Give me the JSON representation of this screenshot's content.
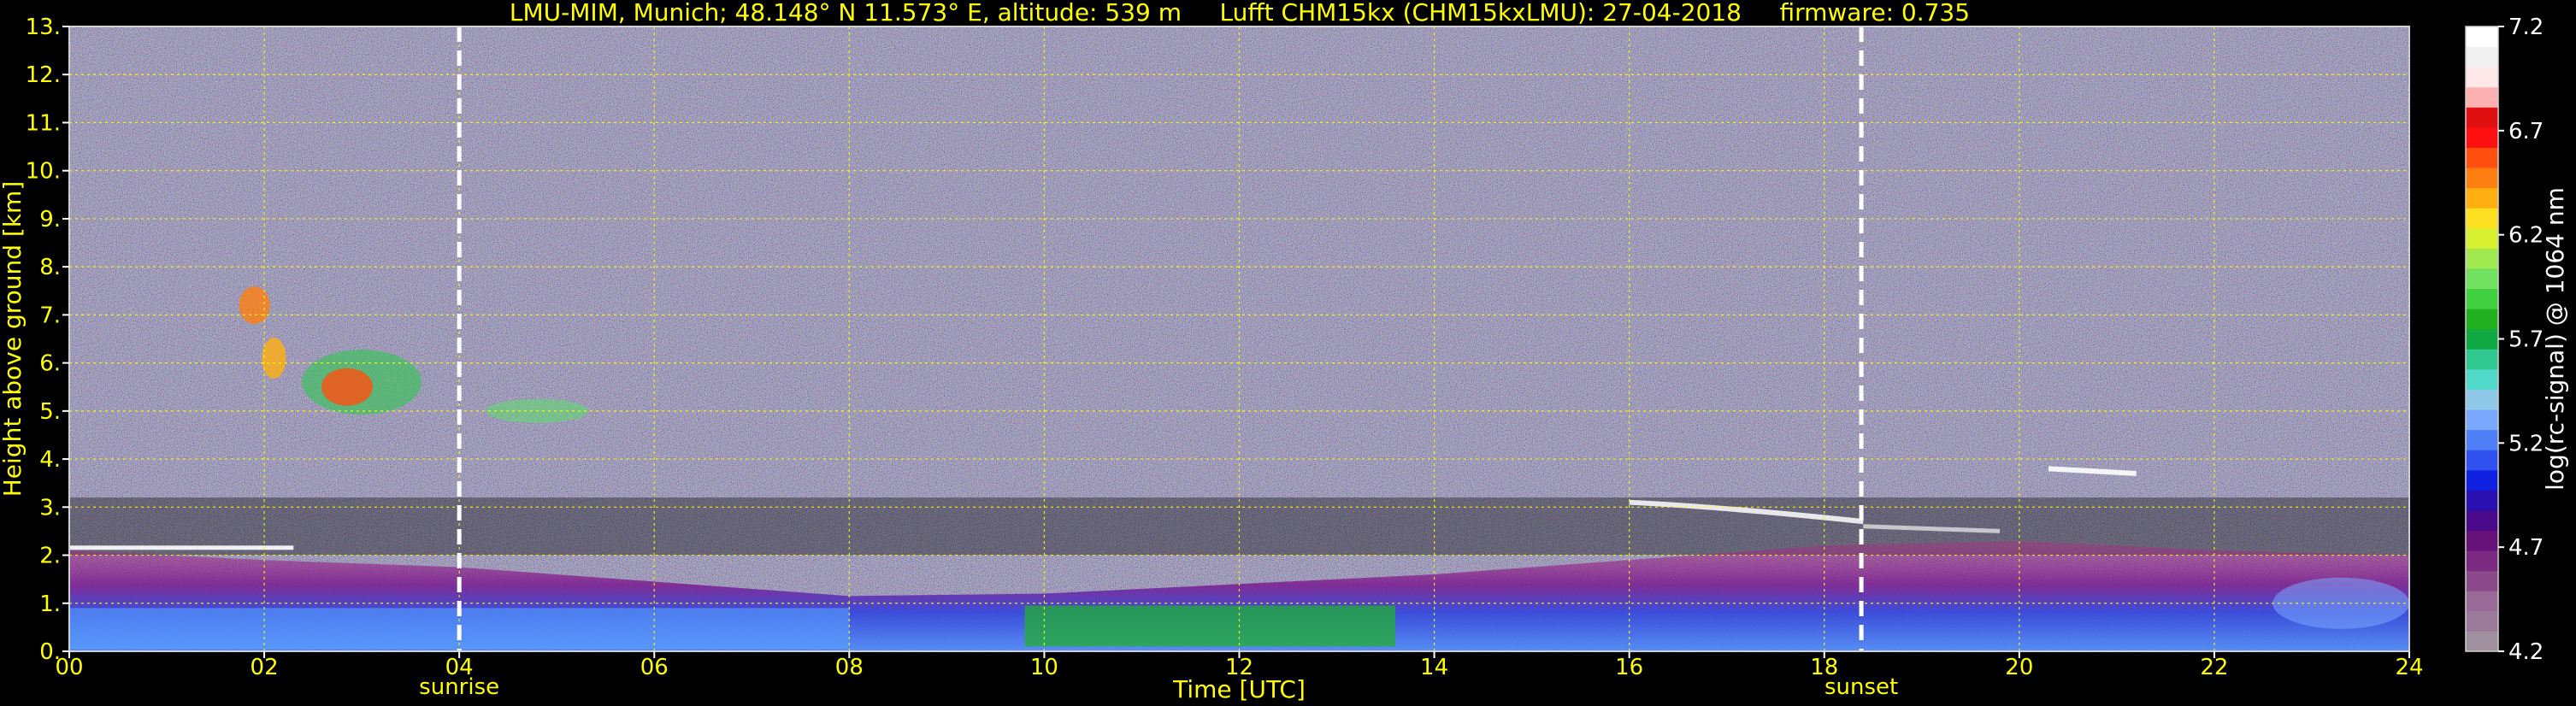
{
  "chart_data": {
    "type": "heatmap",
    "title": "LMU-MIM, Munich; 48.148° N 11.573° E, altitude: 539 m     Lufft CHM15kx (CHM15kxLMU): 27-04-2018     firmware: 0.735",
    "xlabel": "Time [UTC]",
    "ylabel": "Height above ground [km]",
    "xlim": [
      0,
      24
    ],
    "ylim": [
      0,
      13
    ],
    "x_ticks": [
      "00",
      "02",
      "04",
      "06",
      "08",
      "10",
      "12",
      "14",
      "16",
      "18",
      "20",
      "22",
      "24"
    ],
    "y_ticks": [
      "0.",
      "1.",
      "2.",
      "3.",
      "4.",
      "5.",
      "6.",
      "7.",
      "8.",
      "9.",
      "10.",
      "11.",
      "12.",
      "13."
    ],
    "grid": true,
    "annotations": [
      {
        "label": "sunrise",
        "x": 4.0
      },
      {
        "label": "sunset",
        "x": 18.38
      }
    ],
    "colorbar": {
      "label": "log(rc-signal) @ 1064 nm",
      "range": [
        4.2,
        7.2
      ],
      "ticks": [
        "4.2",
        "4.7",
        "5.2",
        "5.7",
        "6.2",
        "6.7",
        "7.2"
      ],
      "colors": [
        "#a0909f",
        "#9a7a99",
        "#9a6a98",
        "#8a4a8a",
        "#7a2a80",
        "#66107a",
        "#4a0a8a",
        "#2a10b0",
        "#1020e0",
        "#3050f0",
        "#5080f8",
        "#7aa8ff",
        "#90c8e8",
        "#50d8c8",
        "#30c890",
        "#10a840",
        "#20b020",
        "#40d040",
        "#70e060",
        "#a0e850",
        "#d8f030",
        "#ffe020",
        "#ffb010",
        "#ff8010",
        "#ff5010",
        "#ff1010",
        "#e01010",
        "#ffb0b0",
        "#ffe8e8",
        "#f0f0f0",
        "#ffffff"
      ]
    },
    "colors": {
      "axis_text": "#ffff00",
      "grid": "#ffff00",
      "background": "#000000",
      "marker_line": "#ffffff"
    }
  }
}
